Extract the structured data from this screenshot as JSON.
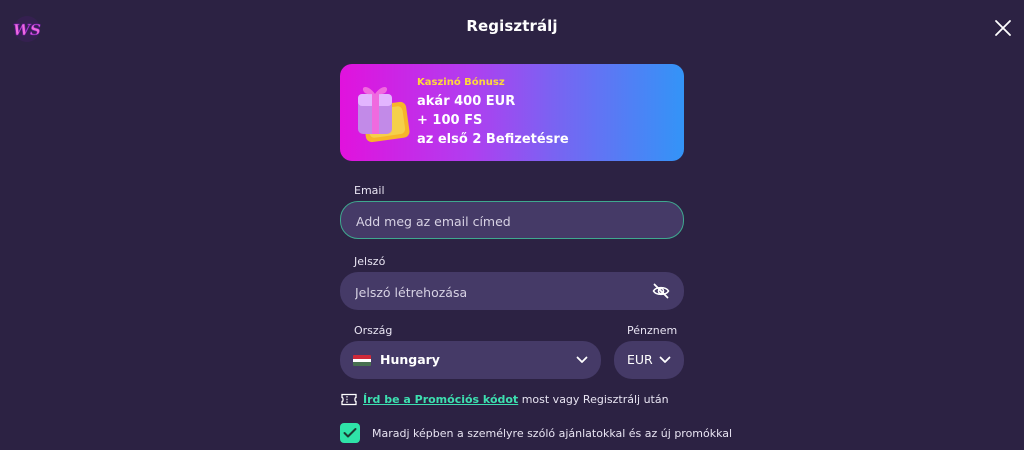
{
  "header": {
    "logo_text": "WS",
    "title": "Regisztrálj"
  },
  "banner": {
    "kicker": "Kaszinó Bónusz",
    "line1": "akár 400 EUR",
    "line2": "+ 100 FS",
    "line3": "az első 2 Befizetésre"
  },
  "form": {
    "email": {
      "label": "Email",
      "placeholder": "Add meg az email címed",
      "value": ""
    },
    "password": {
      "label": "Jelszó",
      "placeholder": "Jelszó létrehozása",
      "value": ""
    },
    "country": {
      "label": "Ország",
      "value": "Hungary"
    },
    "currency": {
      "label": "Pénznem",
      "value": "EUR"
    },
    "promo": {
      "link": "Írd be a Promóciós kódot",
      "rest": " most vagy Regisztrálj után"
    },
    "consent": {
      "checked": true,
      "text": "Maradj képben a személyre szóló ajánlatokkal és az új promókkal"
    }
  },
  "colors": {
    "background": "#2c2243",
    "field": "#453a67",
    "accent": "#2fe3a8",
    "banner_kicker": "#ffd93a"
  },
  "icons": [
    "ws-logo-icon",
    "close-icon",
    "gift-icon",
    "eye-off-icon",
    "hungary-flag-icon",
    "chevron-down-icon",
    "ticket-icon",
    "checkmark-icon"
  ]
}
